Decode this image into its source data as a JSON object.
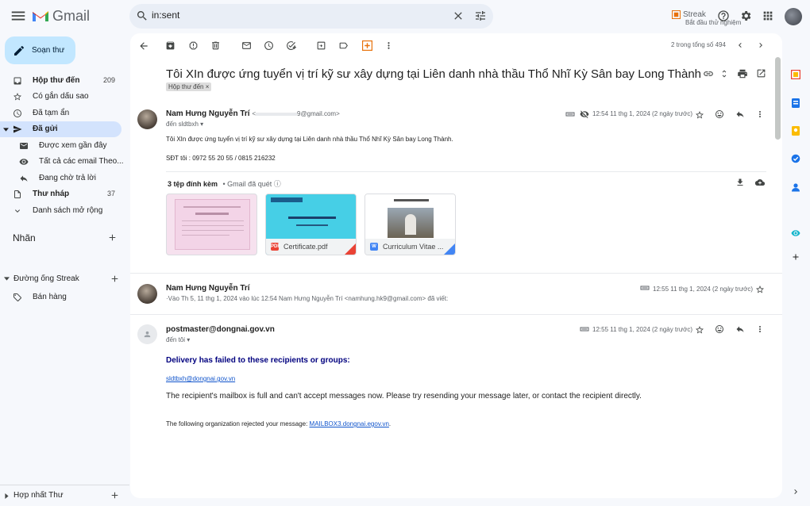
{
  "app": {
    "name": "Gmail"
  },
  "search": {
    "value": "in:sent"
  },
  "streak": {
    "title": "Streak",
    "subtitle": "Bắt đầu thử nghiệm"
  },
  "compose": {
    "label": "Soạn thư"
  },
  "sidebar": {
    "items": [
      {
        "label": "Hộp thư đến",
        "count": "209",
        "icon": "inbox-icon"
      },
      {
        "label": "Có gắn dấu sao",
        "count": "",
        "icon": "star-icon"
      },
      {
        "label": "Đã tạm ẩn",
        "count": "",
        "icon": "clock-icon"
      },
      {
        "label": "Đã gửi",
        "count": "",
        "icon": "send-icon"
      },
      {
        "label": "Được xem gần đây",
        "count": "",
        "icon": "mail-open-icon"
      },
      {
        "label": "Tất cả các email Theo...",
        "count": "",
        "icon": "eye-icon"
      },
      {
        "label": "Đang chờ trả lời",
        "count": "",
        "icon": "reply-icon"
      },
      {
        "label": "Thư nháp",
        "count": "37",
        "icon": "draft-icon"
      },
      {
        "label": "Danh sách mở rộng",
        "count": "",
        "icon": "chevron-down-icon"
      }
    ],
    "labels_title": "Nhãn",
    "pipeline_title": "Đường ống Streak",
    "pipeline_item": "Bán hàng",
    "footer": "Hợp nhất Thư"
  },
  "toolbar": {
    "pager": "2 trong tổng số 494"
  },
  "thread": {
    "subject": "Tôi XIn được ứng tuyển vị trí kỹ sư xây dựng tại Liên danh nhà thầu Thổ Nhĩ Kỳ Sân bay Long Thành",
    "label": "Hộp thư đến",
    "label_close": "×",
    "messages": [
      {
        "sender": "Nam Hưng Nguyễn Trí",
        "email": "<",
        "email_tail": "9@gmail.com>",
        "to": "đến sldtbxh",
        "date": "12:54 11 thg 1, 2024 (2 ngày trước)",
        "body": [
          "Tôi XIn được ứng tuyển vị trí kỹ sư xây dựng tại Liên danh nhà thầu Thổ Nhĩ Kỳ Sân bay Long Thành.",
          "SĐT tôi : 0972 55 20 55 / 0815 216232"
        ],
        "attachments_title": "3 tệp đính kèm",
        "attachments_scan": "• Gmail đã quét",
        "attachments": [
          {
            "name": "",
            "type": "image"
          },
          {
            "name": "Certificate.pdf",
            "type": "PDF"
          },
          {
            "name": "Curriculum Vitae ...",
            "type": "W"
          }
        ]
      },
      {
        "sender": "Nam Hưng Nguyễn Trí",
        "snippet": "Vào Th 5, 11 thg 1, 2024 vào lúc 12:54 Nam Hưng Nguyễn Trí <namhung.hk9@gmail.com> đã viết:",
        "date": "12:55 11 thg 1, 2024 (2 ngày trước)"
      },
      {
        "sender": "postmaster@dongnai.gov.vn",
        "to": "đến tôi",
        "date": "12:55 11 thg 1, 2024 (2 ngày trước)",
        "delivery_title": "Delivery has failed to these recipients or groups:",
        "recipient": "sldtbxh@dongnai.gov.vn",
        "mailbox_text": "The recipient's mailbox is full and can't accept messages now. Please try resending your message later, or contact the recipient directly.",
        "org_text": "The following organization rejected your message: ",
        "org_link": "MAILBOX3.dongnai.egov.vn",
        "org_end": "."
      }
    ]
  },
  "colors": {
    "accent": "#0b57d0",
    "compose": "#c2e7ff",
    "active_nav": "#d3e3fd",
    "delivery": "#00007f"
  }
}
